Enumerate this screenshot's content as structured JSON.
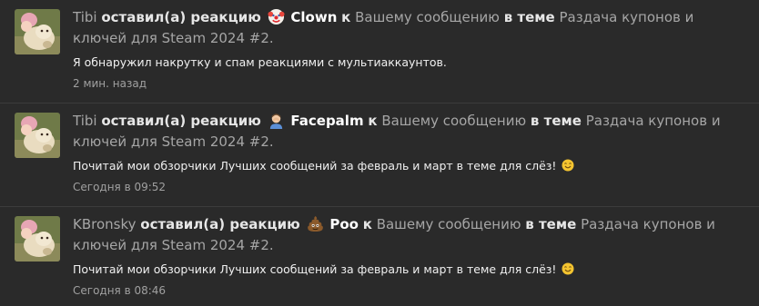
{
  "notifications": [
    {
      "user": "Tibi",
      "action": "оставил(а) реакцию",
      "reaction_icon": "clown-face-icon",
      "reaction": "Clown",
      "to": "к",
      "target": "Вашему сообщению",
      "in_thread": "в теме",
      "thread": "Раздача купонов и ключей для Steam 2024 #2.",
      "excerpt": "Я обнаружил накрутку и спам реакциями с мультиаккаунтов.",
      "time": "2 мин. назад"
    },
    {
      "user": "Tibi",
      "action": "оставил(а) реакцию",
      "reaction_icon": "facepalm-icon",
      "reaction": "Facepalm",
      "to": "к",
      "target": "Вашему сообщению",
      "in_thread": "в теме",
      "thread": "Раздача купонов и ключей для Steam 2024 #2.",
      "excerpt": "Почитай мои обзорчики Лучших сообщений за февраль и март в теме для слёз!",
      "excerpt_icon": "smiling-face-icon",
      "time": "Сегодня в 09:52"
    },
    {
      "user": "KBronsky",
      "action": "оставил(а) реакцию",
      "reaction_icon": "pile-of-poo-icon",
      "reaction": "Poo",
      "to": "к",
      "target": "Вашему сообщению",
      "in_thread": "в теме",
      "thread": "Раздача купонов и ключей для Steam 2024 #2.",
      "excerpt": "Почитай мои обзорчики Лучших сообщений за февраль и март в теме для слёз!",
      "excerpt_icon": "smiling-face-icon",
      "time": "Сегодня в 08:46"
    }
  ]
}
